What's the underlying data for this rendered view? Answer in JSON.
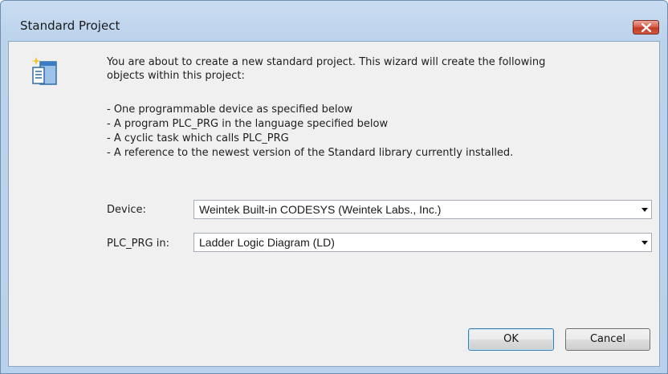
{
  "window": {
    "title": "Standard Project"
  },
  "intro": {
    "line1": "You are about to create a new standard project. This wizard will create the following",
    "line2": "objects within this project:"
  },
  "bullets": [
    "- One programmable device as specified below",
    "- A program PLC_PRG in the language specified below",
    "- A cyclic task which calls PLC_PRG",
    "- A reference to the newest version of the Standard library currently installed."
  ],
  "fields": {
    "device": {
      "label": "Device:",
      "value": "Weintek Built-in CODESYS (Weintek Labs., Inc.)"
    },
    "plc_prg": {
      "label": "PLC_PRG in:",
      "value": "Ladder Logic Diagram (LD)"
    }
  },
  "buttons": {
    "ok": "OK",
    "cancel": "Cancel"
  },
  "colors": {
    "close_button": "#c9432e",
    "frame": "#bcd3ec",
    "client": "#f0f0f0"
  },
  "icons": {
    "close": "close-x-icon",
    "wizard": "new-project-wizard-icon"
  }
}
